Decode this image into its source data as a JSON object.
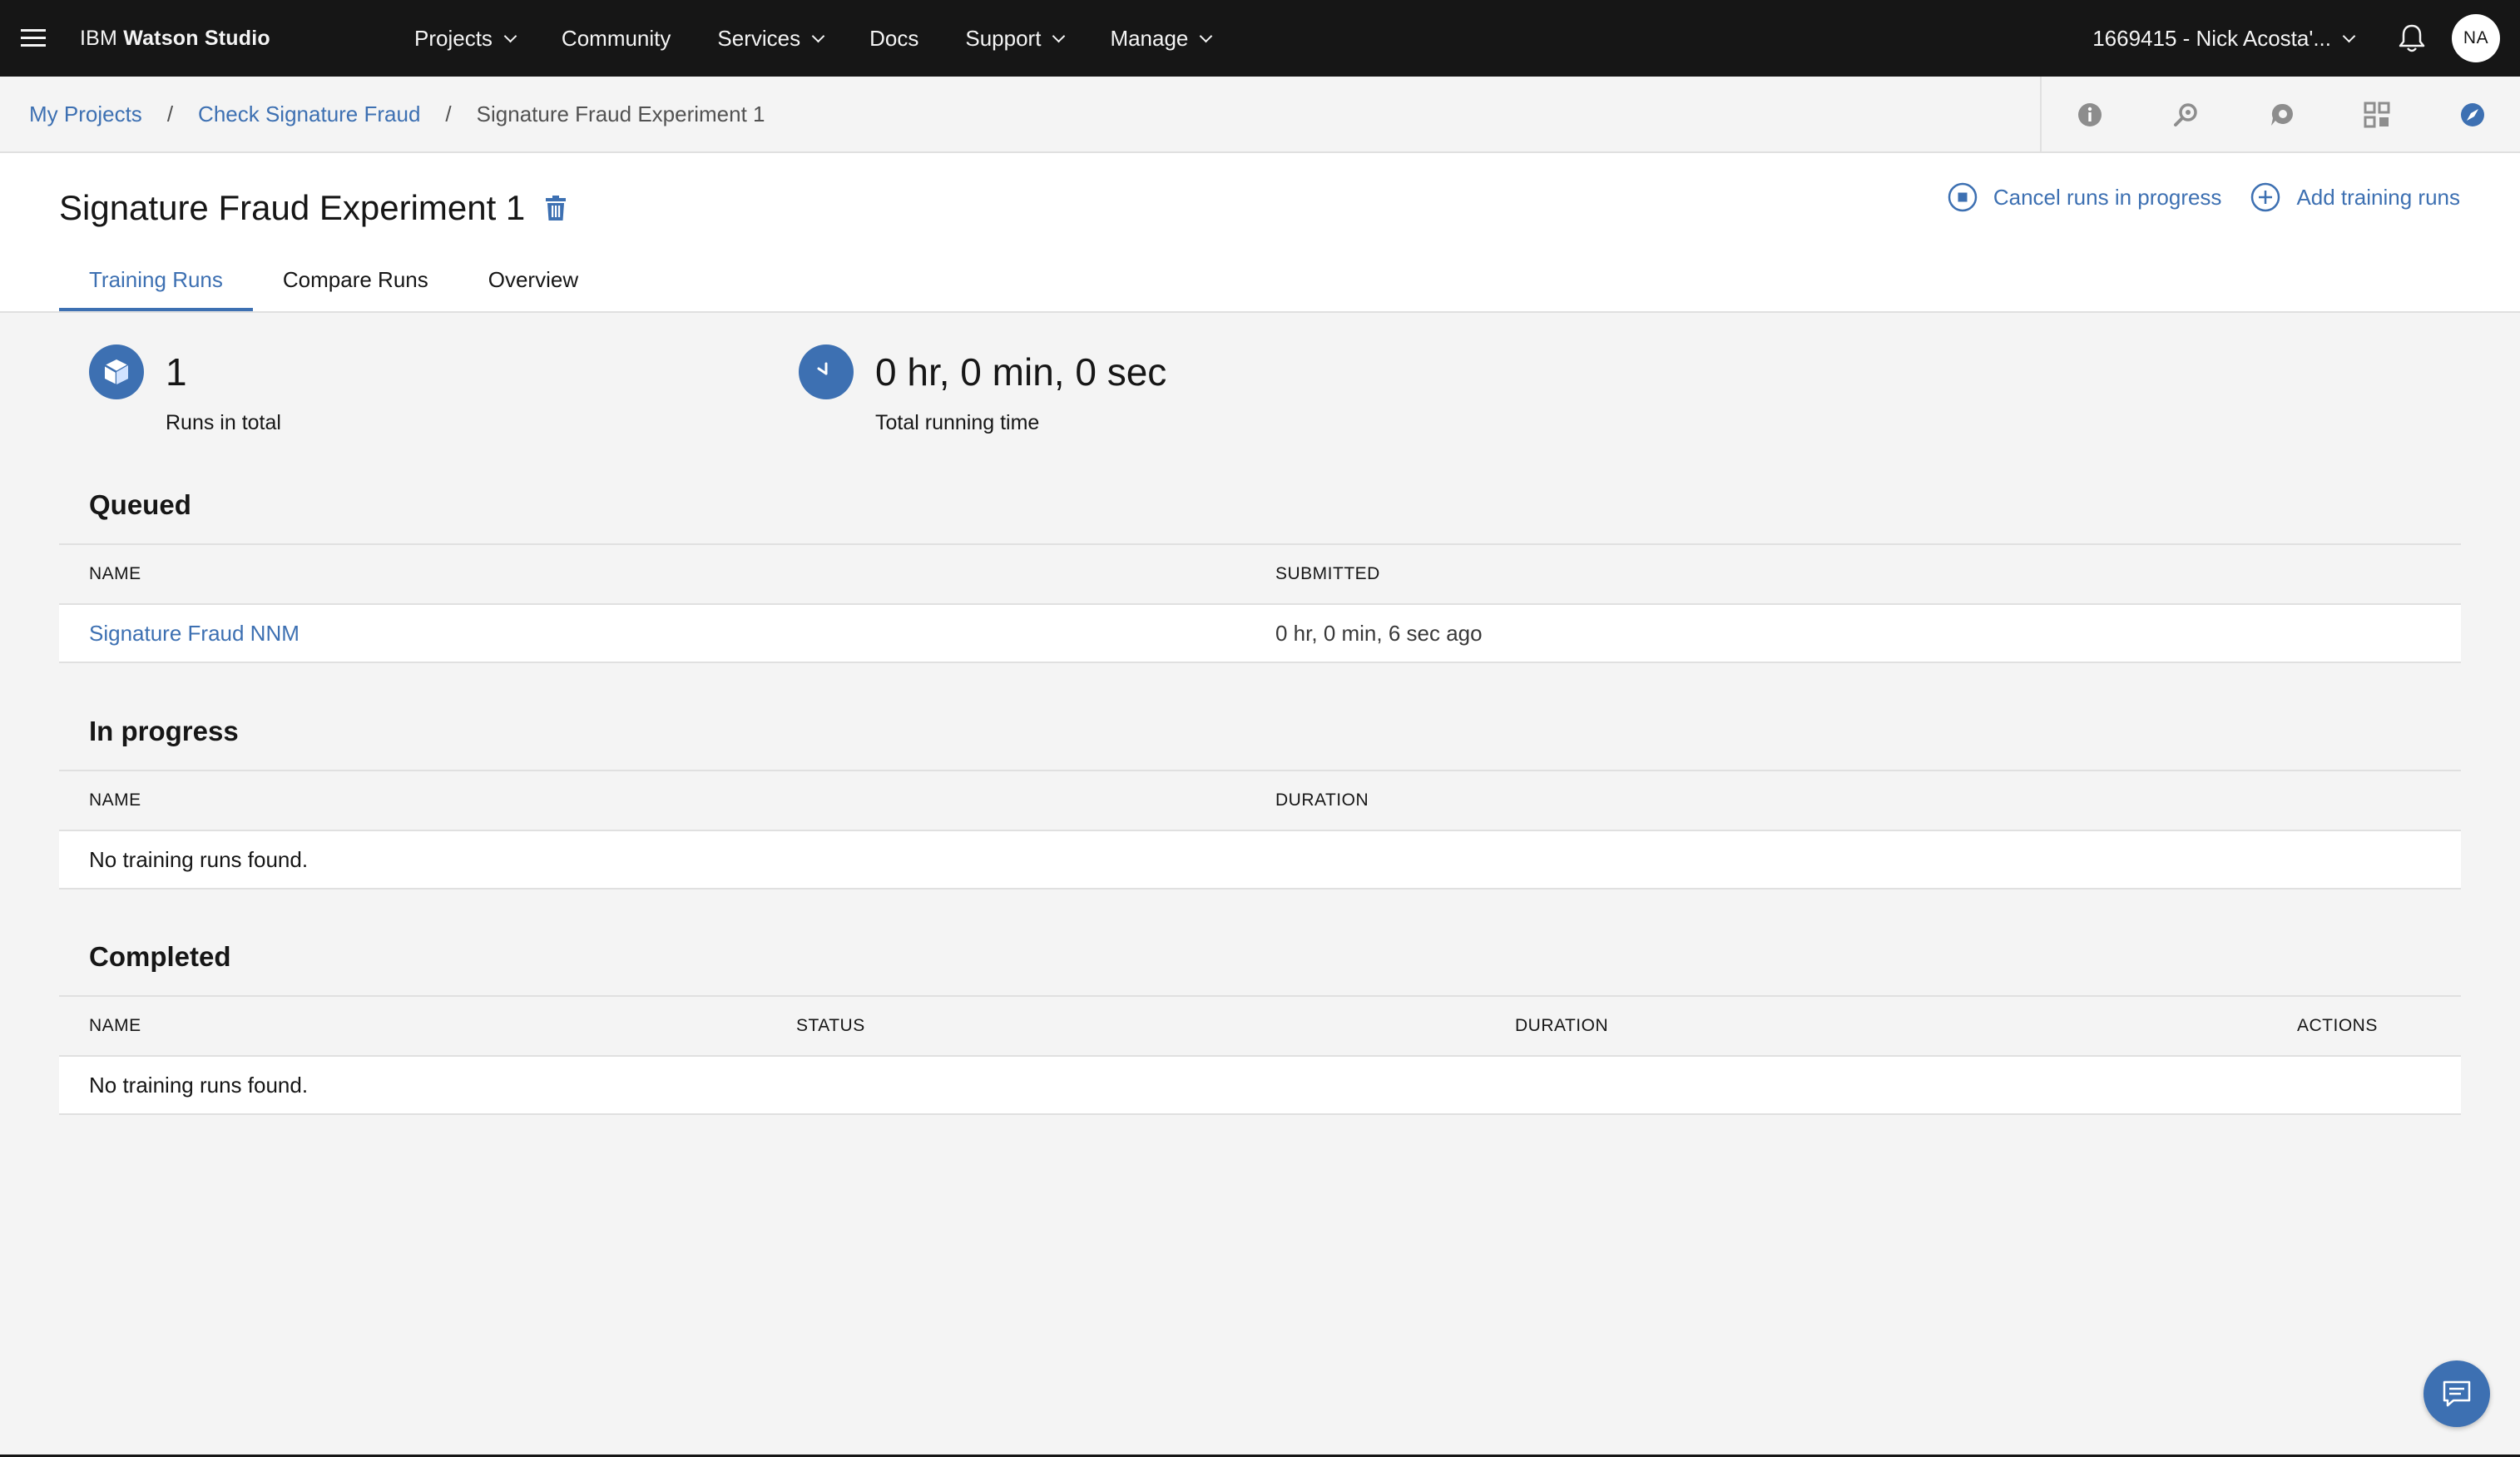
{
  "header": {
    "brand_prefix": "IBM",
    "brand_name": "Watson Studio",
    "nav": {
      "projects": "Projects",
      "community": "Community",
      "services": "Services",
      "docs": "Docs",
      "support": "Support",
      "manage": "Manage"
    },
    "account": "1669415 - Nick Acosta'...",
    "avatar_initials": "NA"
  },
  "breadcrumb": {
    "items": [
      "My Projects",
      "Check Signature Fraud"
    ],
    "separator": "/",
    "current": "Signature Fraud Experiment 1"
  },
  "toolbar_icons": [
    "info-icon",
    "find-icon",
    "chat-icon",
    "apps-icon",
    "compass-icon"
  ],
  "page": {
    "title": "Signature Fraud Experiment 1",
    "cancel_label": "Cancel runs in progress",
    "add_label": "Add training runs",
    "tabs": [
      "Training Runs",
      "Compare Runs",
      "Overview"
    ],
    "active_tab": "Training Runs"
  },
  "stats": {
    "runs_total_value": "1",
    "runs_total_label": "Runs in total",
    "running_time_value": "0 hr, 0 min, 0 sec",
    "running_time_label": "Total running time"
  },
  "queued": {
    "title": "Queued",
    "columns": [
      "NAME",
      "SUBMITTED"
    ],
    "rows": [
      {
        "name": "Signature Fraud NNM",
        "submitted": "0 hr, 0 min, 6 sec ago"
      }
    ]
  },
  "in_progress": {
    "title": "In progress",
    "columns": [
      "NAME",
      "DURATION"
    ],
    "empty": "No training runs found."
  },
  "completed": {
    "title": "Completed",
    "columns": [
      "NAME",
      "STATUS",
      "DURATION",
      "ACTIONS"
    ],
    "empty": "No training runs found."
  },
  "colors": {
    "accent": "#3d70b2",
    "header_bg": "#161616",
    "page_bg": "#f4f4f4"
  }
}
